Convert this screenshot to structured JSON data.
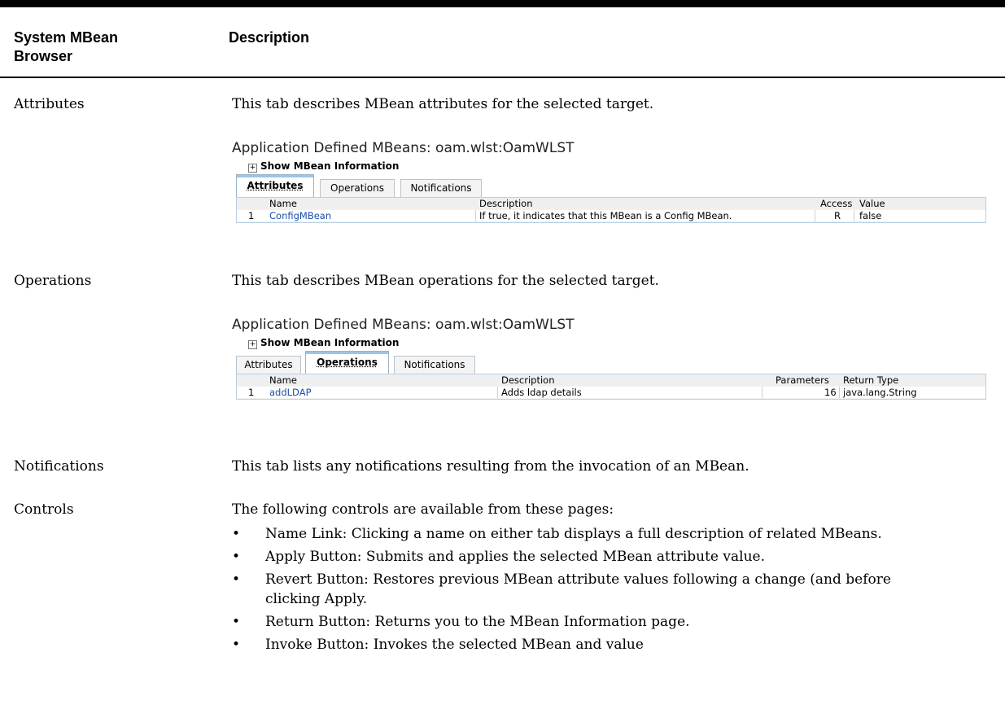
{
  "header": {
    "col1": "System MBean Browser",
    "col2": "Description"
  },
  "rows": {
    "attributes": {
      "label": "Attributes",
      "desc": "This tab describes MBean attributes for the selected target.",
      "shot": {
        "title": "Application Defined MBeans: oam.wlst:OamWLST",
        "info": "Show MBean Information",
        "tabs": [
          "Attributes",
          "Operations",
          "Notifications"
        ],
        "columns": [
          "Name",
          "Description",
          "Access",
          "Value"
        ],
        "row": {
          "num": "1",
          "name": "ConfigMBean",
          "description": "If true, it indicates that this MBean is a Config MBean.",
          "access": "R",
          "value": "false"
        }
      }
    },
    "operations": {
      "label": "Operations",
      "desc": "This tab describes MBean operations for the selected target.",
      "shot": {
        "title": "Application Defined MBeans: oam.wlst:OamWLST",
        "info": "Show MBean Information",
        "tabs": [
          "Attributes",
          "Operations",
          "Notifications"
        ],
        "columns": [
          "Name",
          "Description",
          "Parameters",
          "Return Type"
        ],
        "row": {
          "num": "1",
          "name": "addLDAP",
          "description": "Adds ldap details",
          "parameters": "16",
          "return_type": "java.lang.String"
        }
      }
    },
    "notifications": {
      "label": "Notifications",
      "desc": "This tab lists any notifications resulting from the invocation of an MBean."
    },
    "controls": {
      "label": "Controls",
      "desc": "The following controls are available from these pages:",
      "bullets": [
        "Name Link: Clicking a name on either tab displays a full description of related MBeans.",
        "Apply Button: Submits and applies the selected MBean attribute value.",
        "Revert Button: Restores previous MBean attribute values following a change (and before clicking Apply.",
        "Return Button: Returns you to the MBean Information page.",
        "Invoke Button: Invokes the selected MBean and value"
      ]
    }
  }
}
